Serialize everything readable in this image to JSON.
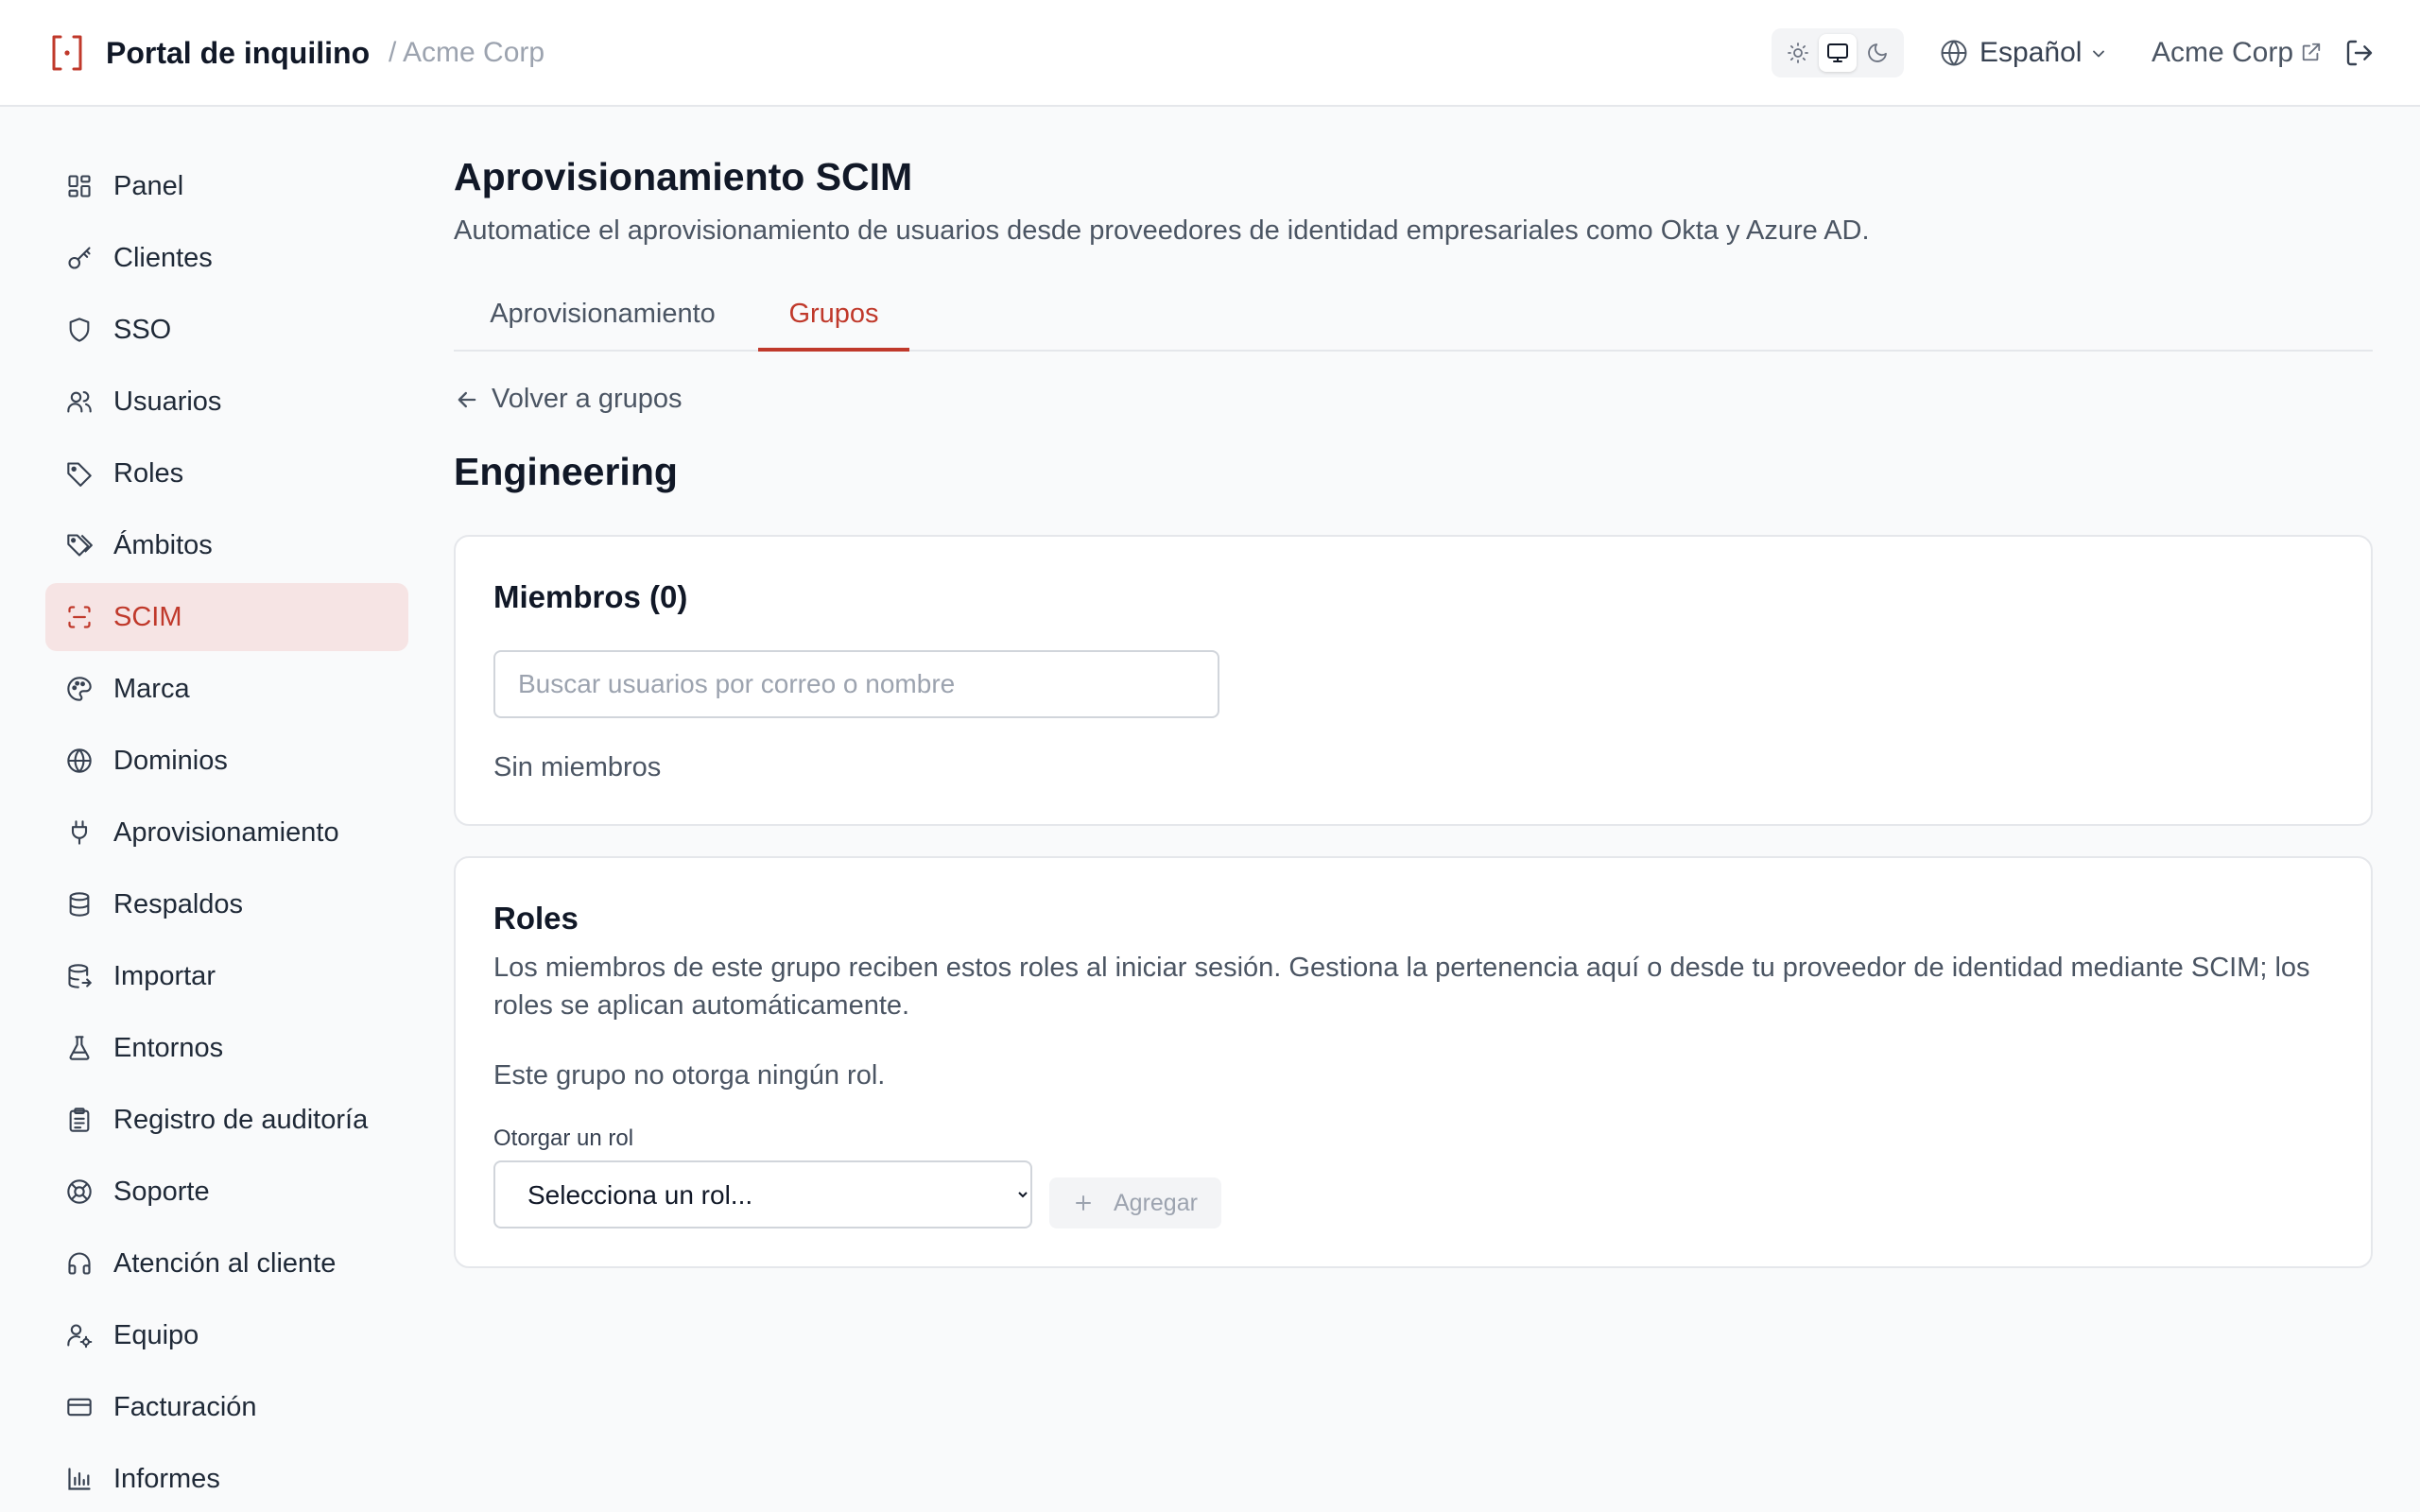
{
  "header": {
    "app_title": "Portal de inquilino",
    "tenant_breadcrumb": "/ Acme Corp",
    "theme_options": [
      "light",
      "system",
      "dark"
    ],
    "theme_selected": "system",
    "language": "Español",
    "tenant_link": "Acme Corp"
  },
  "sidebar": {
    "items": [
      {
        "label": "Panel",
        "icon": "dashboard-icon"
      },
      {
        "label": "Clientes",
        "icon": "key-icon"
      },
      {
        "label": "SSO",
        "icon": "shield-icon"
      },
      {
        "label": "Usuarios",
        "icon": "users-icon"
      },
      {
        "label": "Roles",
        "icon": "tag-icon"
      },
      {
        "label": "Ámbitos",
        "icon": "tags-icon"
      },
      {
        "label": "SCIM",
        "icon": "scan-icon"
      },
      {
        "label": "Marca",
        "icon": "palette-icon"
      },
      {
        "label": "Dominios",
        "icon": "globe-icon"
      },
      {
        "label": "Aprovisionamiento",
        "icon": "plug-icon"
      },
      {
        "label": "Respaldos",
        "icon": "database-icon"
      },
      {
        "label": "Importar",
        "icon": "database-import-icon"
      },
      {
        "label": "Entornos",
        "icon": "flask-icon"
      },
      {
        "label": "Registro de auditoría",
        "icon": "clipboard-icon"
      },
      {
        "label": "Soporte",
        "icon": "life-buoy-icon"
      },
      {
        "label": "Atención al cliente",
        "icon": "headphones-icon"
      },
      {
        "label": "Equipo",
        "icon": "user-cog-icon"
      },
      {
        "label": "Facturación",
        "icon": "credit-card-icon"
      },
      {
        "label": "Informes",
        "icon": "bar-chart-icon"
      }
    ],
    "active_label": "SCIM"
  },
  "main": {
    "title": "Aprovisionamiento SCIM",
    "subtitle": "Automatice el aprovisionamiento de usuarios desde proveedores de identidad empresariales como Okta y Azure AD.",
    "tabs": [
      {
        "label": "Aprovisionamiento",
        "active": false
      },
      {
        "label": "Grupos",
        "active": true
      }
    ],
    "back_link": "Volver a grupos",
    "group_name": "Engineering",
    "members": {
      "title": "Miembros (0)",
      "search_placeholder": "Buscar usuarios por correo o nombre",
      "search_value": "",
      "empty_text": "Sin miembros"
    },
    "roles": {
      "title": "Roles",
      "description": "Los miembros de este grupo reciben estos roles al iniciar sesión. Gestiona la pertenencia aquí o desde tu proveedor de identidad mediante SCIM; los roles se aplican automáticamente.",
      "empty_text": "Este grupo no otorga ningún rol.",
      "grant_label": "Otorgar un rol",
      "select_value": "Selecciona un rol...",
      "add_button": "Agregar"
    }
  },
  "colors": {
    "accent": "#c0392b",
    "active_nav_bg": "#f6e4e4",
    "page_bg": "#f9fafb",
    "text_muted": "#4b5563"
  }
}
